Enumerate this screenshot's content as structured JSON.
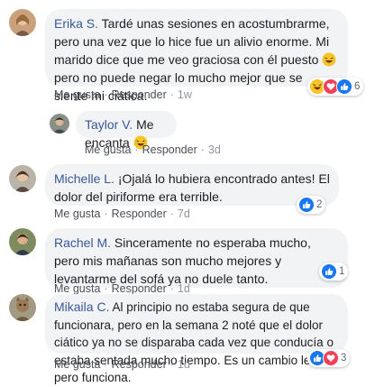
{
  "actions": {
    "like": "Me gusta",
    "reply": "Responder",
    "separator": "·"
  },
  "comments": [
    {
      "author": "Erika S.",
      "text_part1": "Tardé unas sesiones en acostumbrarme, pero una vez que lo hice fue un alivio enorme. Mi marido dice que me veo graciosa con él puesto",
      "text_part2": " pero no puede negar lo mucho mejor que se siente mi ciática.",
      "time": "1w",
      "reaction_count": "6",
      "reaction_icons": [
        "laugh-reaction-icon",
        "love-reaction-icon",
        "like-reaction-icon"
      ]
    },
    {
      "author": "Taylor V.",
      "text_part1": "Me encanta",
      "time": "3d"
    },
    {
      "author": "Michelle L.",
      "text_part1": "¡Ojalá lo hubiera encontrado antes! El dolor del piriforme era terrible.",
      "time": "7d",
      "reaction_count": "2",
      "reaction_icons": [
        "like-reaction-icon"
      ]
    },
    {
      "author": "Rachel M.",
      "text_part1": "Sinceramente no esperaba mucho, pero mis mañanas son mucho mejores y levantarme del sofá ya no duele tanto.",
      "time": "1d",
      "reaction_count": "1",
      "reaction_icons": [
        "like-reaction-icon"
      ]
    },
    {
      "author": "Mikaila C.",
      "text_part1": "Al principio no estaba segura de que funcionara, pero en la semana 2 noté que el dolor ciático ya no se disparaba cada vez que conducía o estaba sentada mucho tiempo. Es un cambio lento pero funciona.",
      "time": "1d",
      "reaction_count": "3",
      "reaction_icons": [
        "like-reaction-icon",
        "love-reaction-icon"
      ]
    }
  ],
  "colors": {
    "name": "#385898",
    "bubble": "#f2f3f5",
    "like": "#1877f2",
    "love": "#f33e58",
    "haha": "#f7b125"
  }
}
